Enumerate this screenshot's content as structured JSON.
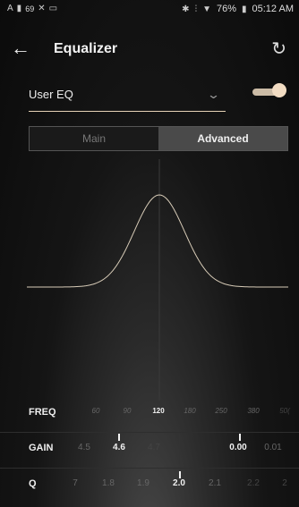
{
  "status": {
    "left_text": "69",
    "battery": "76%",
    "time": "05:12 AM"
  },
  "header": {
    "title": "Equalizer"
  },
  "preset": {
    "selected": "User EQ"
  },
  "eq_enabled": true,
  "tabs": [
    {
      "label": "Main",
      "active": false
    },
    {
      "label": "Advanced",
      "active": true
    }
  ],
  "freq": {
    "label": "FREQ",
    "values": [
      "60",
      "90",
      "120",
      "180",
      "250",
      "380",
      "50("
    ],
    "selected_index": 2
  },
  "gain": {
    "label": "GAIN",
    "left_values": [
      "4.5",
      "4.6",
      "4.7"
    ],
    "left_selected_index": 1,
    "right_values": [
      "0.00",
      "0.01"
    ],
    "right_selected_index": 0
  },
  "q": {
    "label": "Q",
    "values": [
      "7",
      "1.8",
      "1.9",
      "2.0",
      "2.1",
      "2.2",
      "2"
    ],
    "selected_index": 3
  },
  "colors": {
    "accent": "#e7d3b7",
    "curve": "#d8ccb8"
  }
}
